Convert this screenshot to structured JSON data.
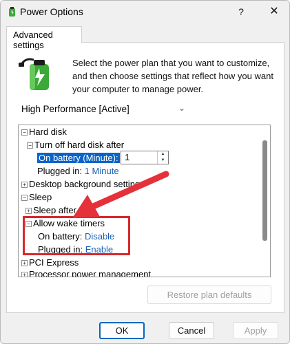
{
  "window": {
    "title": "Power Options",
    "help_glyph": "?",
    "close_glyph": "✕"
  },
  "tab": {
    "label": "Advanced settings"
  },
  "intro_text": "Select the power plan that you want to customize, and then choose settings that reflect how you want your computer to manage power.",
  "plan_select": {
    "value": "High Performance [Active]"
  },
  "tree": {
    "hard_disk": "Hard disk",
    "turn_off_hard_disk": "Turn off hard disk after",
    "on_battery_minute": "On battery (Minute):",
    "spin_value": "1",
    "plugged_in_label": "Plugged in:",
    "plugged_in_value": "1 Minute",
    "desktop_background": "Desktop background settings",
    "sleep": "Sleep",
    "sleep_after": "Sleep after",
    "allow_wake_timers": "Allow wake timers",
    "on_battery_label": "On battery:",
    "on_battery_value": "Disable",
    "plugged_in_label2": "Plugged in:",
    "plugged_in_value2": "Enable",
    "pci_express": "PCI Express",
    "processor_power": "Processor power management"
  },
  "buttons": {
    "restore": "Restore plan defaults",
    "ok": "OK",
    "cancel": "Cancel",
    "apply": "Apply"
  },
  "colors": {
    "accent": "#0067c0",
    "highlight": "#d9272e",
    "link": "#1a5fb4"
  }
}
